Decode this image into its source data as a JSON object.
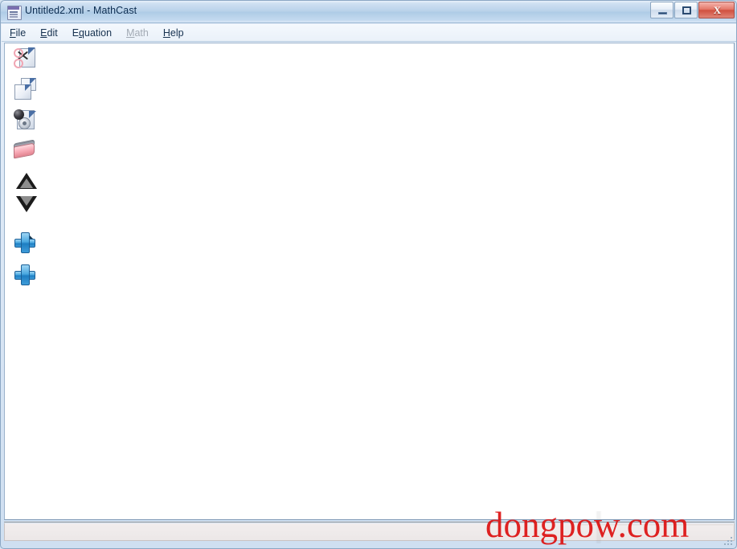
{
  "window": {
    "title": "Untitled2.xml - MathCast",
    "app_icon": "document-xml-icon",
    "controls": {
      "minimize_label": "Minimize",
      "maximize_label": "Maximize",
      "close_label": "Close",
      "close_glyph": "X",
      "close_color": "#d0503f"
    }
  },
  "menubar": {
    "items": [
      {
        "label": "File",
        "accel": "F",
        "disabled": false
      },
      {
        "label": "Edit",
        "accel": "E",
        "disabled": false
      },
      {
        "label": "Equation",
        "accel": "q",
        "disabled": false
      },
      {
        "label": "Math",
        "accel": "M",
        "disabled": true
      },
      {
        "label": "Help",
        "accel": "H",
        "disabled": false
      }
    ]
  },
  "toolbar": {
    "orientation": "vertical",
    "buttons": [
      {
        "name": "cut-icon",
        "label": "Cut"
      },
      {
        "name": "copy-icon",
        "label": "Copy"
      },
      {
        "name": "paste-icon",
        "label": "Paste"
      },
      {
        "name": "eraser-icon",
        "label": "Erase"
      },
      {
        "name": "triangle-up-icon",
        "label": "Move Up"
      },
      {
        "name": "triangle-down-icon",
        "label": "Move Down"
      },
      {
        "name": "insert-right-icon",
        "label": "Insert Right"
      },
      {
        "name": "insert-icon",
        "label": "Insert"
      }
    ]
  },
  "document": {
    "content": "",
    "background": "#ffffff"
  },
  "statusbar": {
    "text": ""
  },
  "watermark": {
    "text": "dongpow.com",
    "color": "#dd1111"
  }
}
